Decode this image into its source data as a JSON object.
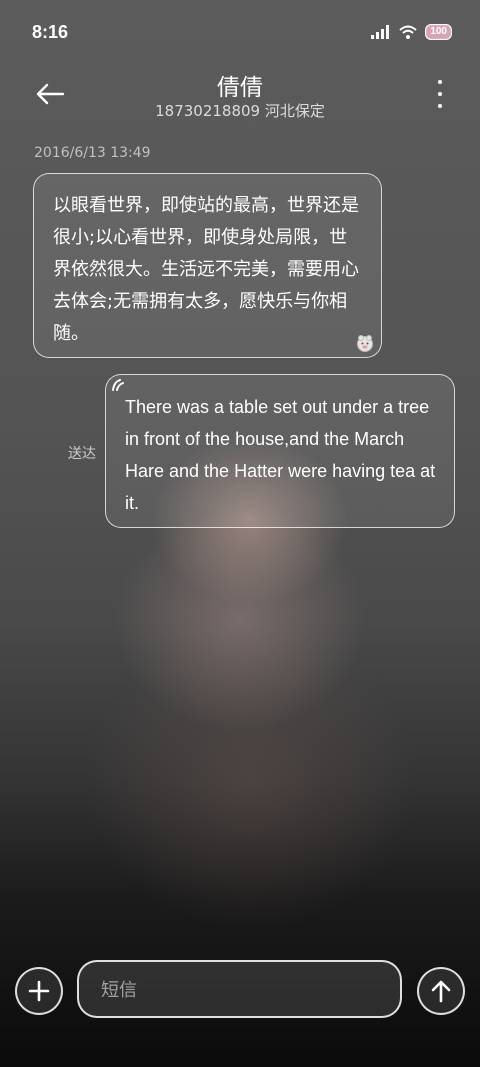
{
  "status_bar": {
    "time": "8:16",
    "battery": "100",
    "icons": [
      "signal-icon",
      "wifi-icon",
      "battery-icon"
    ]
  },
  "header": {
    "contact_name": "倩倩",
    "contact_sub": "18730218809 河北保定",
    "icons": [
      "back-arrow-icon",
      "more-vertical-icon"
    ]
  },
  "conversation": {
    "timestamp": "2016/6/13 13:49",
    "incoming": {
      "text": "以眼看世界，即使站的最高，世界还是很小;以心看世界，即使身处局限，世界依然很大。生活远不完美，需要用心去体会;无需拥有太多，愿快乐与你相随。"
    },
    "outgoing": {
      "text": "There was a table set out under a tree in front of the house,and the March Hare and the Hatter were having tea at it.",
      "status": "送达"
    }
  },
  "composer": {
    "placeholder": "短信",
    "value": "",
    "icons": [
      "plus-icon",
      "send-arrow-up-icon"
    ]
  },
  "colors": {
    "battery_fill": "#d9a3b7",
    "background_top": "#5c5c5c",
    "background_bottom": "#0b0b0b"
  }
}
